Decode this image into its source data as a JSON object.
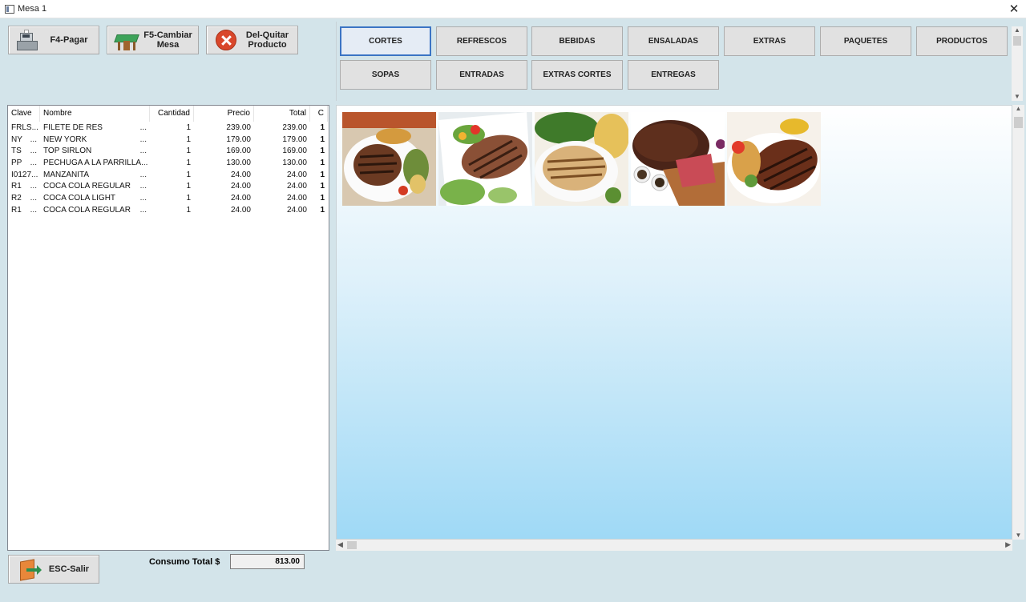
{
  "window": {
    "title": "Mesa 1",
    "close_glyph": "✕"
  },
  "actions": {
    "pay_label": "F4-Pagar",
    "change_table_label": "F5-Cambiar\nMesa",
    "remove_label": "Del-Quitar\nProducto",
    "exit_label": "ESC-Salir"
  },
  "order": {
    "headers": {
      "clave": "Clave",
      "nombre": "Nombre",
      "cantidad": "Cantidad",
      "precio": "Precio",
      "total": "Total",
      "c": "C"
    },
    "rows": [
      {
        "clave": "FRLS",
        "nombre": "FILETE DE RES",
        "cantidad": "1",
        "precio": "239.00",
        "total": "239.00",
        "c": "1"
      },
      {
        "clave": "NY",
        "nombre": "NEW YORK",
        "cantidad": "1",
        "precio": "179.00",
        "total": "179.00",
        "c": "1"
      },
      {
        "clave": "TS",
        "nombre": "TOP SIRLON",
        "cantidad": "1",
        "precio": "169.00",
        "total": "169.00",
        "c": "1"
      },
      {
        "clave": "PP",
        "nombre": "PECHUGA A LA PARRILLA",
        "cantidad": "1",
        "precio": "130.00",
        "total": "130.00",
        "c": "1"
      },
      {
        "clave": "I0127",
        "nombre": "MANZANITA",
        "cantidad": "1",
        "precio": "24.00",
        "total": "24.00",
        "c": "1"
      },
      {
        "clave": "R1",
        "nombre": "COCA COLA REGULAR",
        "cantidad": "1",
        "precio": "24.00",
        "total": "24.00",
        "c": "1"
      },
      {
        "clave": "R2",
        "nombre": "COCA COLA LIGHT",
        "cantidad": "1",
        "precio": "24.00",
        "total": "24.00",
        "c": "1"
      },
      {
        "clave": "R1",
        "nombre": "COCA COLA REGULAR",
        "cantidad": "1",
        "precio": "24.00",
        "total": "24.00",
        "c": "1"
      }
    ],
    "ellipsis": "..."
  },
  "totals": {
    "label": "Consumo Total $",
    "value": "813.00"
  },
  "categories": [
    "CORTES",
    "REFRESCOS",
    "BEBIDAS",
    "ENSALADAS",
    "EXTRAS",
    "PAQUETES",
    "PRODUCTOS",
    "SOPAS",
    "ENTRADAS",
    "EXTRAS CORTES",
    "ENTREGAS"
  ],
  "active_category": "CORTES",
  "products": [
    {
      "name": "grilled-steak-plate-1"
    },
    {
      "name": "grilled-steak-plate-2"
    },
    {
      "name": "grilled-chicken-plate"
    },
    {
      "name": "roast-beef-board"
    },
    {
      "name": "grilled-steak-plate-3"
    }
  ],
  "colors": {
    "accent": "#3b74c4",
    "window_bg": "#d3e4ea"
  }
}
